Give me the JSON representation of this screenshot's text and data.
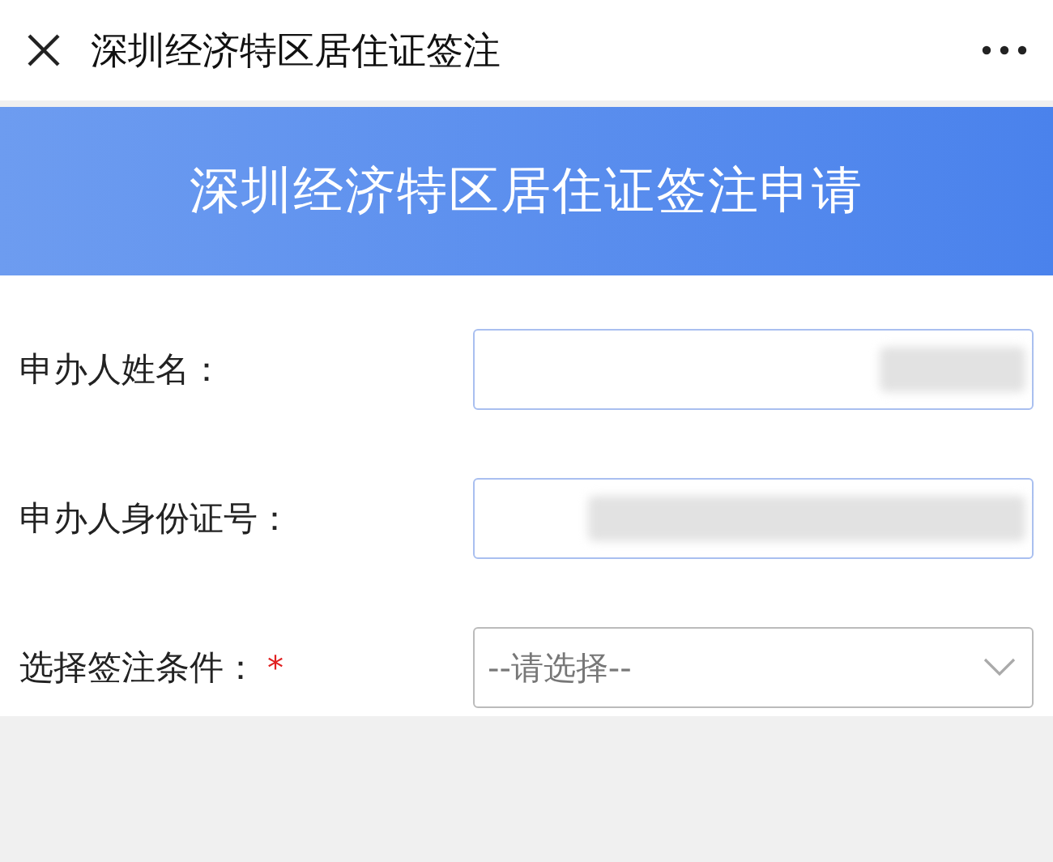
{
  "header": {
    "title": "深圳经济特区居住证签注"
  },
  "banner": {
    "title": "深圳经济特区居住证签注申请"
  },
  "fields": [
    {
      "kind": "text",
      "label": "申办人姓名："
    },
    {
      "kind": "text",
      "label": "申办人身份证号："
    },
    {
      "kind": "select",
      "label": "选择签注条件：",
      "required_mark": "*",
      "placeholder": "--请选择--"
    }
  ]
}
